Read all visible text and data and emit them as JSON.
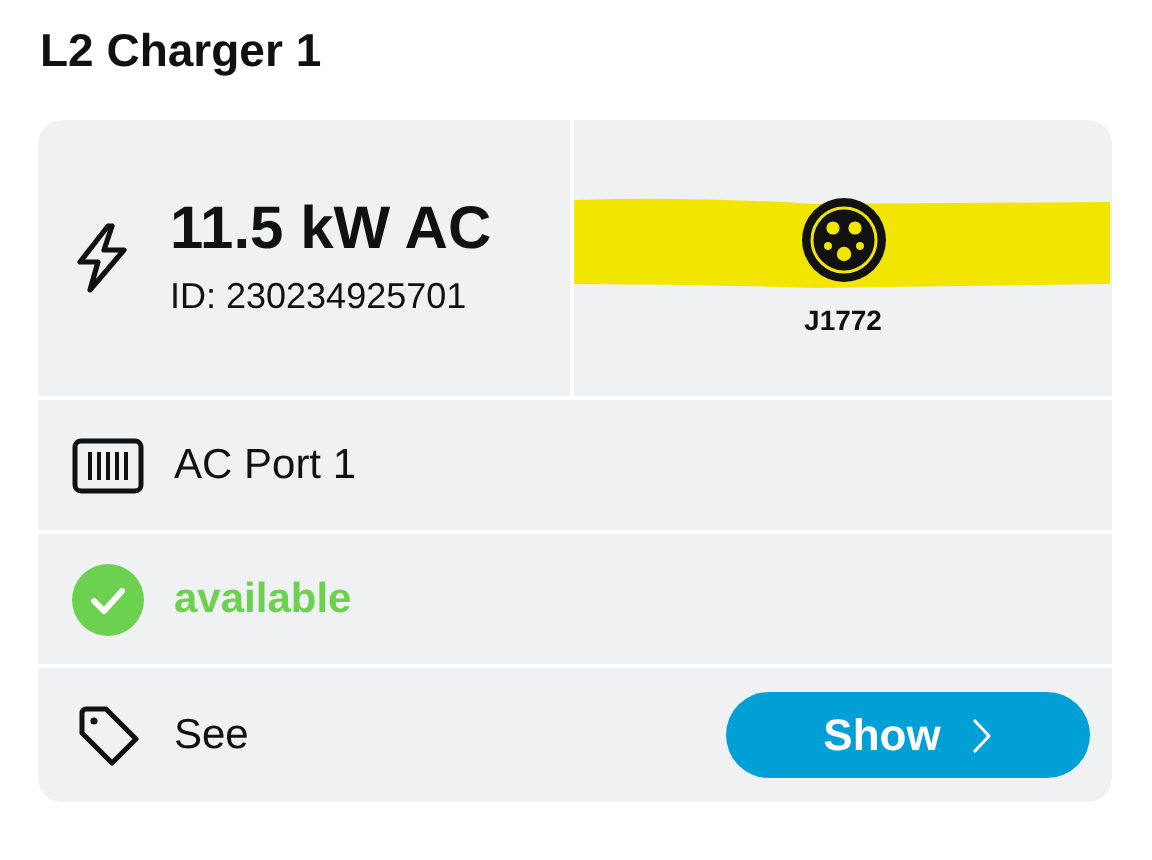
{
  "title": "L2 Charger 1",
  "power": {
    "rating": "11.5 kW AC",
    "id": "ID: 230234925701"
  },
  "connector": {
    "type": "J1772",
    "highlighted": true
  },
  "rows": [
    {
      "kind": "port",
      "label": "AC Port 1"
    },
    {
      "kind": "status",
      "label": "available",
      "available": true
    },
    {
      "kind": "action",
      "label": "See",
      "button": "Show"
    }
  ]
}
